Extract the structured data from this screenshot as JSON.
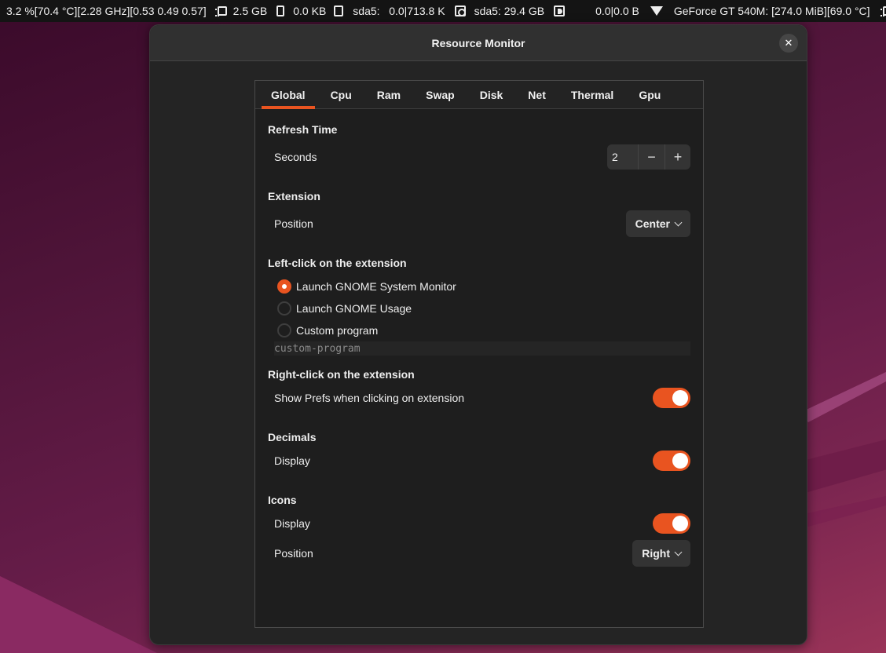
{
  "topbar": {
    "cpu": "3.2 %[70.4 °C][2.28 GHz][0.53 0.49 0.57]",
    "ram": "2.5 GB",
    "swap": "0.0 KB",
    "disk_io": "sda5:   0.0|713.8 K",
    "disk_space": "sda5: 29.4 GB",
    "net": "0.0|0.0 B",
    "gpu": "GeForce GT 540M: [274.0 MiB][69.0 °C]",
    "icons": [
      "cpu-chip-icon",
      "ram-icon",
      "swap-icon",
      "disk-io-icon",
      "disk-space-icon",
      "wifi-icon",
      "gpu-chip-icon"
    ]
  },
  "window": {
    "title": "Resource Monitor",
    "close_label": "✕"
  },
  "tabs": [
    {
      "label": "Global",
      "active": true
    },
    {
      "label": "Cpu"
    },
    {
      "label": "Ram"
    },
    {
      "label": "Swap"
    },
    {
      "label": "Disk"
    },
    {
      "label": "Net"
    },
    {
      "label": "Thermal"
    },
    {
      "label": "Gpu"
    }
  ],
  "sections": {
    "refresh": {
      "title": "Refresh Time",
      "seconds_label": "Seconds",
      "seconds_value": "2",
      "minus": "−",
      "plus": "+"
    },
    "extension": {
      "title": "Extension",
      "position_label": "Position",
      "position_value": "Center"
    },
    "left_click": {
      "title": "Left-click on the extension",
      "options": [
        {
          "label": "Launch GNOME System Monitor",
          "checked": true
        },
        {
          "label": "Launch GNOME Usage",
          "checked": false
        },
        {
          "label": "Custom program",
          "checked": false
        }
      ],
      "custom_program_value": "custom-program"
    },
    "right_click": {
      "title": "Right-click on the extension",
      "show_prefs_label": "Show Prefs when clicking on extension",
      "show_prefs_on": true
    },
    "decimals": {
      "title": "Decimals",
      "display_label": "Display",
      "display_on": true
    },
    "icons": {
      "title": "Icons",
      "display_label": "Display",
      "display_on": true,
      "position_label": "Position",
      "position_value": "Right"
    }
  },
  "colors": {
    "accent": "#e95420",
    "window_bg": "#242424",
    "headerbar_bg": "#303030"
  }
}
